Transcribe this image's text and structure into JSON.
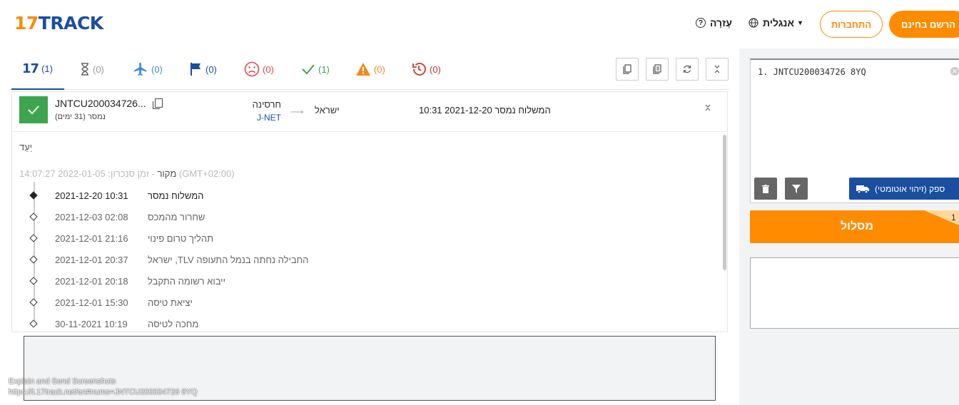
{
  "header": {
    "logo_num": "17",
    "logo_text": "TRACK",
    "help_label": "עֶזרָה",
    "language_label": "אנגלית",
    "login_label": "התחברות",
    "signup_label": "הרשם בחינם"
  },
  "tabs": [
    {
      "icon": "17-logo",
      "count": "(1)",
      "color": "#1a4fa0"
    },
    {
      "icon": "hourglass-icon",
      "count": "(0)",
      "color": "#999999"
    },
    {
      "icon": "airplane-icon",
      "count": "(0)",
      "color": "#3b8fd9"
    },
    {
      "icon": "flag-icon",
      "count": "(0)",
      "color": "#1a4fa0"
    },
    {
      "icon": "sad-face-icon",
      "count": "(0)",
      "color": "#e04848"
    },
    {
      "icon": "check-icon",
      "count": "(1)",
      "color": "#3da54d"
    },
    {
      "icon": "warning-icon",
      "count": "(0)",
      "color": "#f08a1c"
    },
    {
      "icon": "history-icon",
      "count": "(0)",
      "color": "#c0392b"
    }
  ],
  "result": {
    "tracking_number": "JNTCU200034726...",
    "days": "נמסר (31 ימים)",
    "origin": "חרסינה",
    "carrier": "J-NET",
    "destination": "ישראל",
    "last_event": "המשלוח נמסר 2021-12-20 10:31",
    "destination_label": "יַעַד",
    "source_prefix": "מקור",
    "source_sync": " - זמן סנכרון: 2022-01-05 14:07:27 (GMT+02:00)",
    "status_color": "#3da54d"
  },
  "events": [
    {
      "datetime": "2021-12-20 10:31",
      "desc": "המשלוח נמסר"
    },
    {
      "datetime": "2021-12-03 02:08",
      "desc": "שחרור מהמכס"
    },
    {
      "datetime": "2021-12-01 21:16",
      "desc": "תהליך טרום פינוי"
    },
    {
      "datetime": "2021-12-01 20:37",
      "desc": "ישראל ,TLV החבילה נחתה בנמל התעופה"
    },
    {
      "datetime": "2021-12-01 20:18",
      "desc": "ייבוא רשומה התקבל"
    },
    {
      "datetime": "2021-12-01 15:30",
      "desc": "יציאת טיסה"
    },
    {
      "datetime": "30-11-2021 10:19",
      "desc": "מחכה לטיסה"
    }
  ],
  "sidebar": {
    "input_value": "1. JNTCU200034726 8YQ",
    "carrier_button": "ספק (זיהוי אוטומטי)",
    "track_button": "מסלול",
    "badge_count": "1"
  },
  "watermark": {
    "line1": "Explain and Send Screenshots",
    "line2": "https://t.17track.net/en#nums=JNTCU200034726 8YQ"
  },
  "colors": {
    "brand_orange": "#ff8b00",
    "brand_blue": "#1a4fa0",
    "delivered_green": "#3da54d"
  }
}
